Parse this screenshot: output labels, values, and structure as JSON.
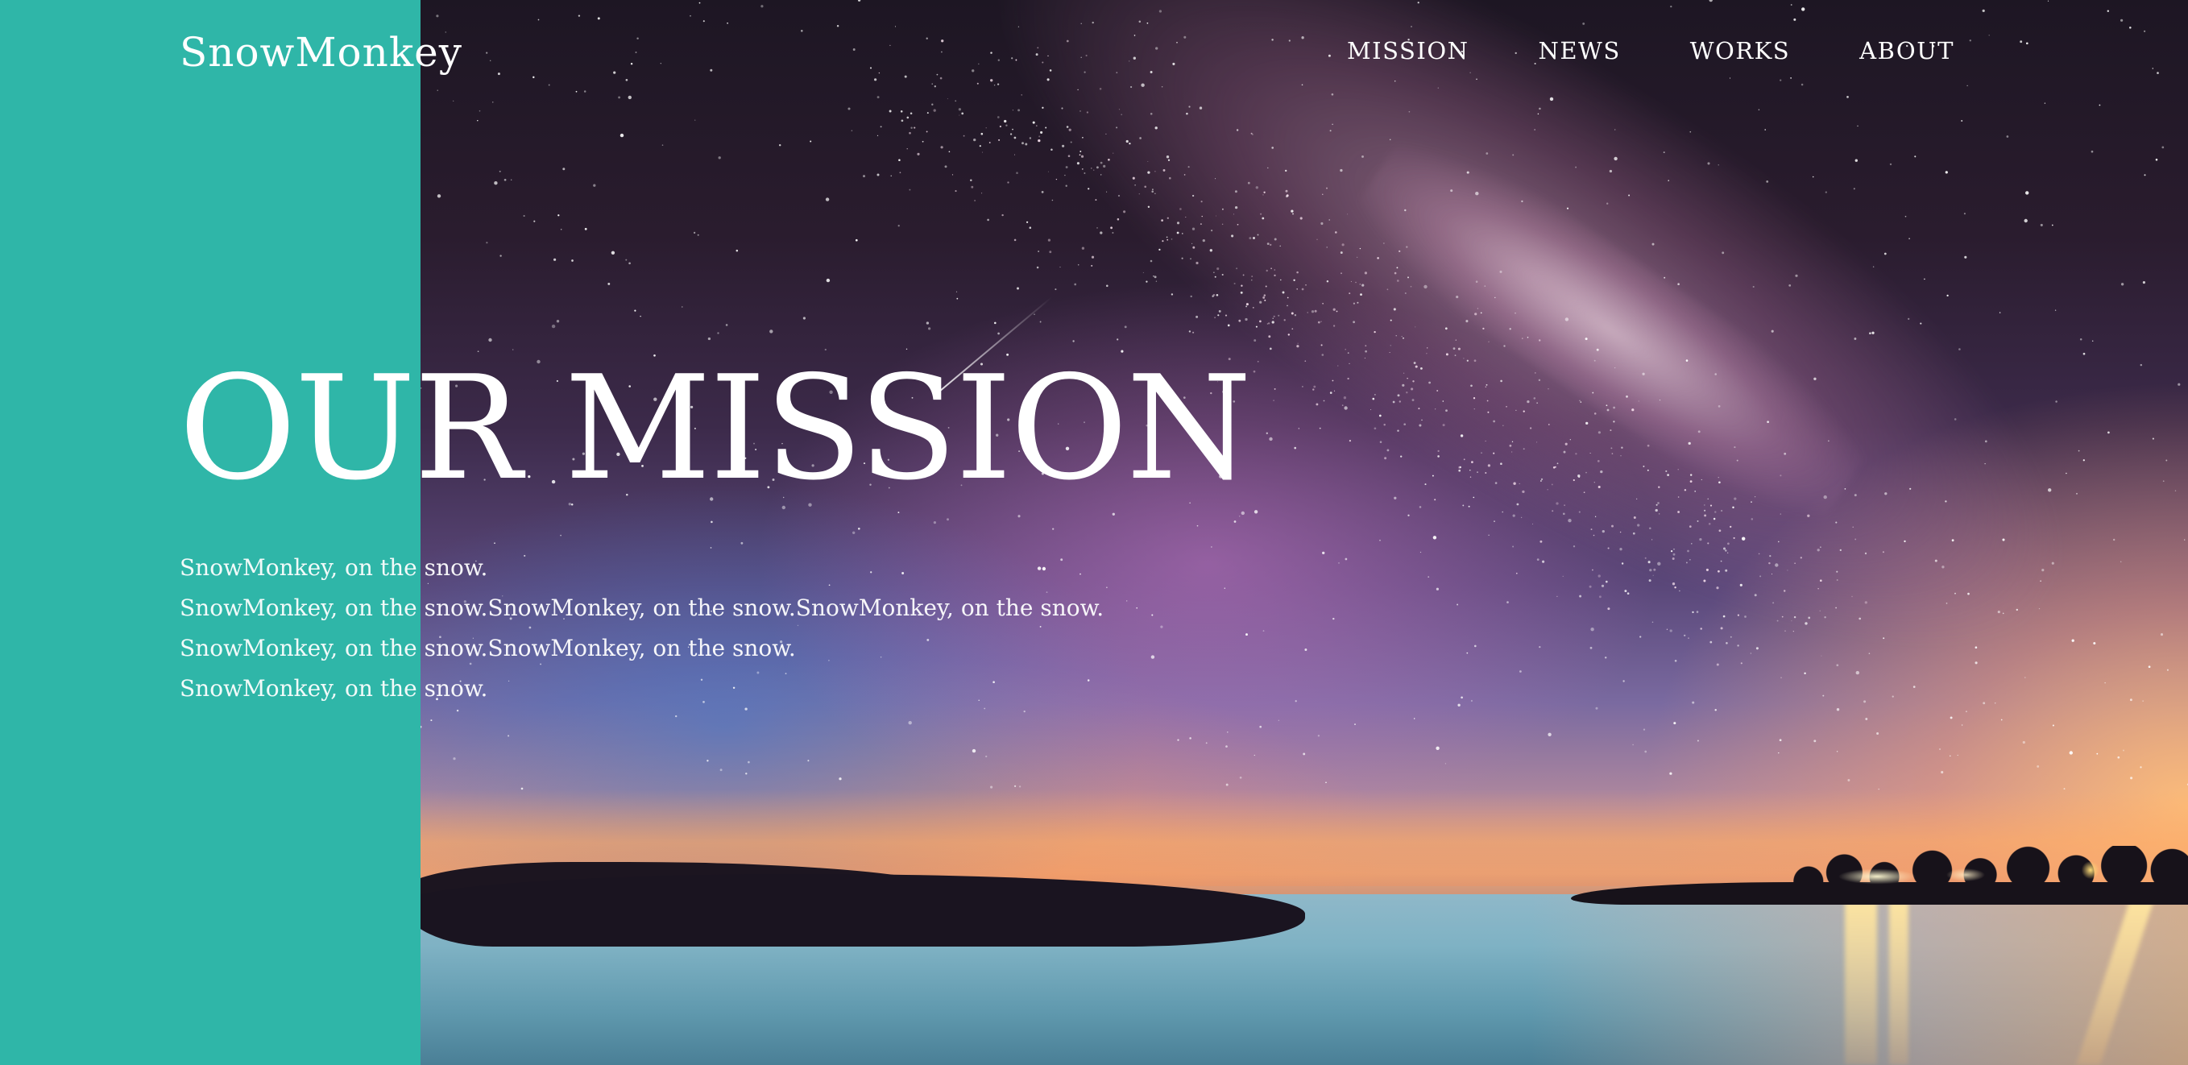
{
  "header": {
    "logo_text": "SnowMonkey",
    "nav": [
      "MISSION",
      "NEWS",
      "WORKS",
      "ABOUT"
    ]
  },
  "hero": {
    "title": "OUR MISSION",
    "lines": [
      "SnowMonkey, on the snow.",
      "SnowMonkey, on the snow.SnowMonkey, on the snow.SnowMonkey, on the snow.",
      "SnowMonkey, on the snow.SnowMonkey, on the snow.",
      "SnowMonkey, on the snow."
    ]
  },
  "colors": {
    "accent_panel": "#2fb6a8",
    "text": "#ffffff"
  }
}
